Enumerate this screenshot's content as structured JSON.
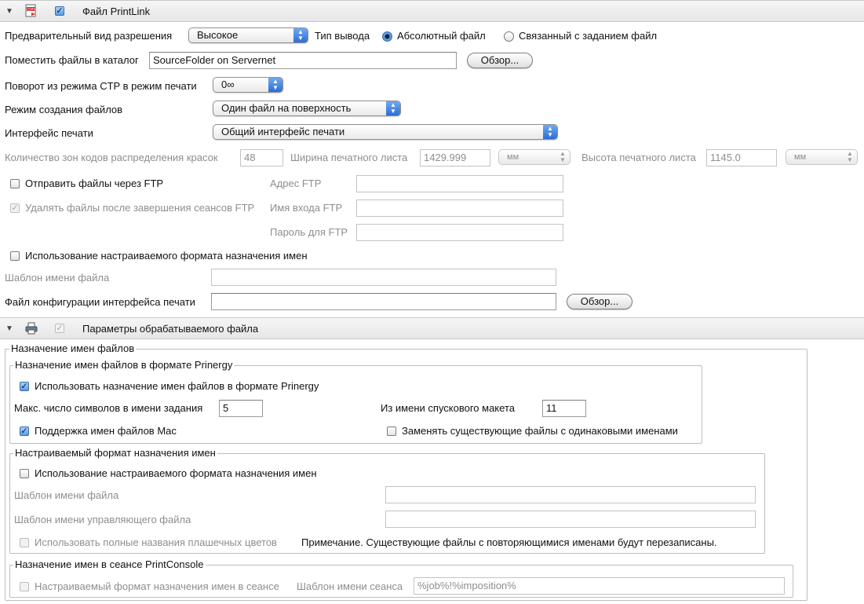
{
  "section1": {
    "title": "Файл PrintLink",
    "enabled_checked": true,
    "preview_resolution": {
      "label": "Предварительный вид разрешения",
      "value": "Высокое"
    },
    "output_type": {
      "label": "Тип вывода",
      "options": [
        "Абсолютный файл",
        "Связанный с заданием файл"
      ],
      "selected": "Абсолютный файл"
    },
    "place_files": {
      "label": "Поместить файлы в каталог",
      "value": "SourceFolder on Servernet",
      "browse": "Обзор..."
    },
    "rotation": {
      "label": "Поворот из режима CTP в режим печати",
      "value": "0∞"
    },
    "file_mode": {
      "label": "Режим создания файлов",
      "value": "Один файл на поверхность"
    },
    "print_interface": {
      "label": "Интерфейс печати",
      "value": "Общий интерфейс печати"
    },
    "ink_zones": {
      "label": "Количество зон кодов распределения красок",
      "value": "48"
    },
    "sheet_width": {
      "label": "Ширина печатного листа",
      "value": "1429.999",
      "unit": "мм"
    },
    "sheet_height": {
      "label": "Высота печатного листа",
      "value": "1145.0",
      "unit": "мм"
    },
    "ftp_send": {
      "label": "Отправить файлы через FTP",
      "checked": false
    },
    "ftp_delete": {
      "label": "Удалять файлы после завершения сеансов FTP",
      "checked": true
    },
    "ftp_address": {
      "label": "Адрес FTP",
      "value": ""
    },
    "ftp_login": {
      "label": "Имя входа FTP",
      "value": ""
    },
    "ftp_password": {
      "label": "Пароль для FTP",
      "value": ""
    },
    "custom_naming": {
      "label": "Использование настраиваемого формата назначения имен",
      "checked": false
    },
    "file_template": {
      "label": "Шаблон имени файла",
      "value": ""
    },
    "config_file": {
      "label": "Файл конфигурации интерфейса печати",
      "value": "",
      "browse": "Обзор..."
    }
  },
  "section2": {
    "title": "Параметры обрабатываемого файла",
    "enabled_checked": true,
    "naming_group": {
      "legend": "Назначение имен файлов",
      "prinergy": {
        "legend": "Назначение имен файлов в формате Prinergy",
        "use_prinergy": {
          "label": "Использовать назначение имен файлов в формате Prinergy",
          "checked": true
        },
        "max_chars": {
          "label": "Макс. число символов в имени задания",
          "value": "5"
        },
        "from_imposition": {
          "label": "Из имени спускового макета",
          "value": "11"
        },
        "mac_support": {
          "label": "Поддержка имен файлов Mac",
          "checked": true
        },
        "replace_existing": {
          "label": "Заменять существующие файлы с одинаковыми именами",
          "checked": false
        }
      },
      "custom": {
        "legend": "Настраиваемый формат назначения имен",
        "use_custom": {
          "label": "Использование настраиваемого формата назначения имен",
          "checked": false
        },
        "file_template": {
          "label": "Шаблон имени файла",
          "value": ""
        },
        "control_template": {
          "label": "Шаблон имени управляющего файла",
          "value": ""
        },
        "full_spot_names": {
          "label": "Использовать полные названия плашечных цветов",
          "checked": false
        },
        "note": "Примечание. Существующие файлы с повторяющимися именами будут перезаписаны."
      },
      "session": {
        "legend": "Назначение имен в сеансе PrintConsole",
        "custom_session": {
          "label": "Настраиваемый формат назначения имен в сеансе",
          "checked": false
        },
        "session_template": {
          "label": "Шаблон имени сеанса",
          "value": "%job%!%imposition%"
        }
      }
    }
  },
  "colors": {
    "accent": "#2c6ed6",
    "disabled_text": "#8e8e8e",
    "header_bg": "#ececec"
  }
}
